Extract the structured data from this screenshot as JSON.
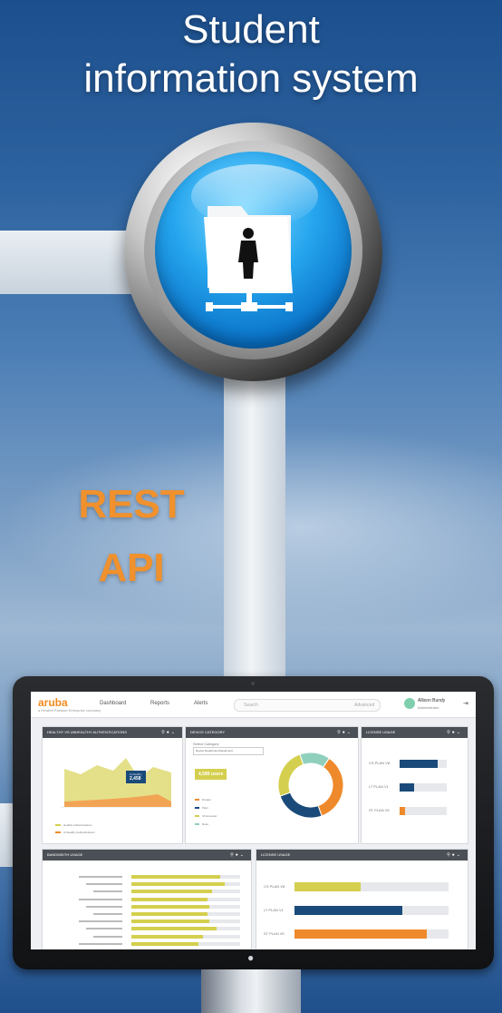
{
  "title": {
    "line1": "Student",
    "line2": "information system"
  },
  "connector": {
    "line1": "REST",
    "line2": "API"
  },
  "icons": {
    "button": "student-folder-network-icon"
  },
  "colors": {
    "accent": "#f0912d",
    "button": "#1a8fe0",
    "brand": "#f28a1e",
    "bar_yellow": "#d4cf4e",
    "bar_navy": "#1a4a7a",
    "bar_orange": "#ef8a2c"
  },
  "dashboard": {
    "brand": "aruba",
    "brand_sub": "a Hewlett Packard Enterprise company",
    "nav": [
      "Dashboard",
      "Reports",
      "Alerts"
    ],
    "search_placeholder": "Search",
    "search_option": "Advanced",
    "user": {
      "name": "Allison Bundy",
      "role": "Administrator"
    },
    "panels": {
      "auth": {
        "title": "HEALTHY VS UNHEALTHY AUTHENTICATIONS",
        "tooltip_label": "Unhealthy",
        "tooltip_value": "2,458",
        "legend": [
          "Healthy Authentications",
          "Unhealthy Authentications"
        ]
      },
      "device": {
        "title": "DEVICE CATEGORY",
        "select_label": "Select Category",
        "select_value": "Device Department Equipment",
        "callout_value": "4,589 users",
        "legend": [
          "Droplet",
          "Palm",
          "Chromecast",
          "Roku"
        ]
      },
      "license": {
        "title": "LICENSE USAGE",
        "rows": [
          "CS PLAN V8",
          "LT PLAN V1",
          "ST PLAN V5"
        ]
      },
      "bandwidth": {
        "title": "BANDWIDTH USAGE"
      },
      "license2": {
        "title": "LICENSE USAGE",
        "rows": [
          "CS PLAN V8",
          "LT PLAN V1",
          "ST PLAN V5"
        ]
      }
    }
  },
  "chart_data": [
    {
      "type": "bar",
      "title": "LICENSE USAGE",
      "categories": [
        "CS PLAN V8",
        "LT PLAN V1",
        "ST PLAN V5"
      ],
      "values": [
        0.43,
        0.7,
        0.86
      ],
      "colors": [
        "#d4cf4e",
        "#1a4a7a",
        "#ef8a2c"
      ]
    },
    {
      "type": "pie",
      "title": "DEVICE CATEGORY",
      "categories": [
        "Droplet",
        "Palm",
        "Chromecast",
        "Roku"
      ],
      "values": [
        35,
        25,
        25,
        15
      ]
    }
  ]
}
